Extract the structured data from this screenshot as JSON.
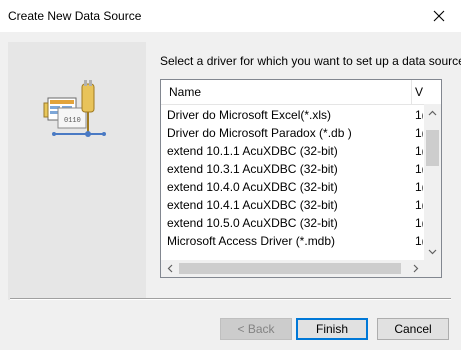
{
  "window": {
    "title": "Create New Data Source",
    "close_glyph": "✕"
  },
  "instruction": "Select a driver for which you want to set up a data source.",
  "list": {
    "columns": [
      "Name",
      "V"
    ],
    "rows": [
      {
        "name": "Driver do Microsoft Excel(*.xls)",
        "version": "1("
      },
      {
        "name": "Driver do Microsoft Paradox (*.db )",
        "version": "1("
      },
      {
        "name": "extend 10.1.1 AcuXDBC (32-bit)",
        "version": "1("
      },
      {
        "name": "extend 10.3.1 AcuXDBC (32-bit)",
        "version": "1("
      },
      {
        "name": "extend 10.4.0 AcuXDBC (32-bit)",
        "version": "1("
      },
      {
        "name": "extend 10.4.1 AcuXDBC (32-bit)",
        "version": "1("
      },
      {
        "name": "extend 10.5.0 AcuXDBC (32-bit)",
        "version": "1("
      },
      {
        "name": "Microsoft Access Driver (*.mdb)",
        "version": "1("
      }
    ]
  },
  "buttons": {
    "back": "< Back",
    "finish": "Finish",
    "cancel": "Cancel"
  },
  "icons": {
    "side": "odbc-data-source-icon",
    "close": "close-icon"
  }
}
